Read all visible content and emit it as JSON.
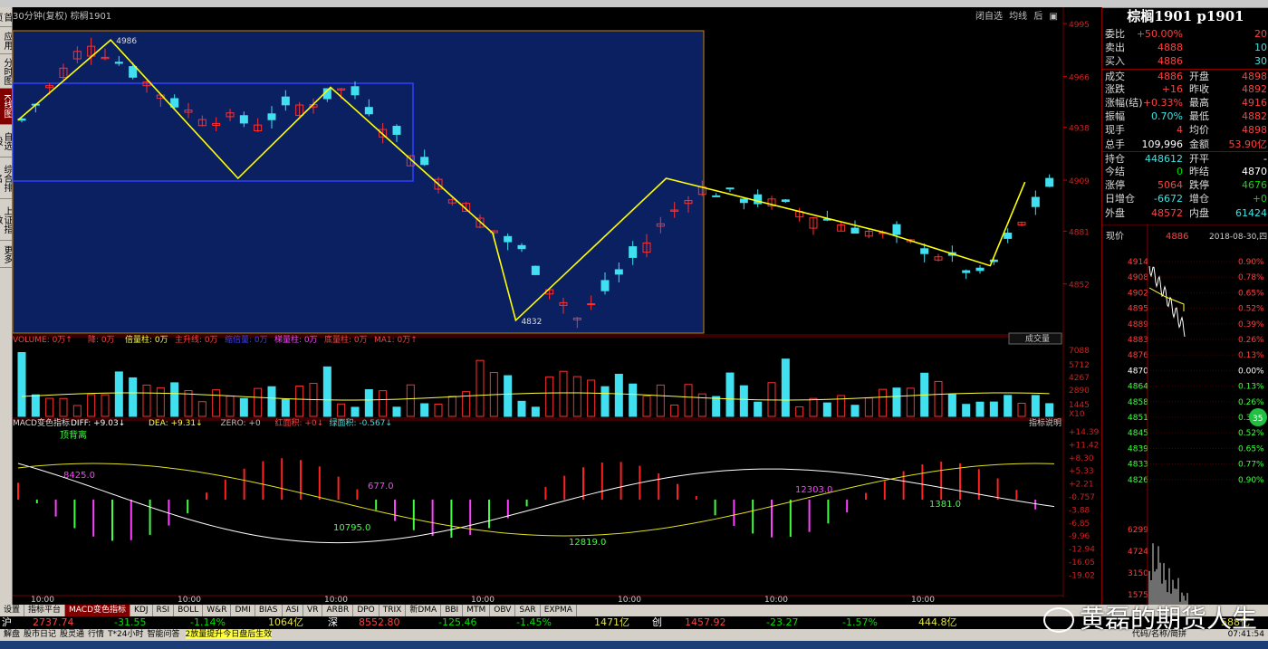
{
  "chart_header": {
    "period": "30分钟(复权)",
    "symbol": "棕榈1901"
  },
  "top_buttons": [
    "闭自选",
    "均线",
    "后"
  ],
  "left_tabs": [
    "首页",
    "应用",
    "分时图",
    "K线图",
    "自选股",
    "综合排名",
    "上证指数",
    "更多"
  ],
  "price_axis": [
    "4995",
    "4966",
    "4938",
    "4909",
    "4881",
    "4852"
  ],
  "price_annotations": {
    "high": "4986",
    "low": "4832"
  },
  "volume_header": {
    "items": [
      "VOLUME: 0万↑",
      "降: 0万",
      "倍量柱: 0万",
      "主升线: 0万",
      "缩倍量: 0万",
      "梯量柱: 0万",
      "底量柱: 0万",
      "MA1: 0万↑"
    ],
    "dropdown": "成交量"
  },
  "volume_axis": [
    "7088",
    "5712",
    "4267",
    "2890",
    "1445",
    "X10"
  ],
  "macd_header": {
    "name": "MACD变色指标",
    "items": [
      "DIFF: +9.03↓",
      "DEA: +9.31↓",
      "ZERO: +0",
      "红面积: +0↓",
      "绿面积: -0.567↓"
    ],
    "help": "指标说明"
  },
  "macd_axis": [
    "+14.39",
    "+11.42",
    "+8.30",
    "+5.33",
    "+2.21",
    "-0.757",
    "-3.88",
    "-6.85",
    "-9.96",
    "-12.94",
    "-16.05",
    "-19.02"
  ],
  "macd_labels": [
    "顶背离",
    "8425.0",
    "677.0",
    "10795.0",
    "12819.0",
    "12303.0",
    "1381.0"
  ],
  "time_axis": [
    "10:00",
    "10:00",
    "10:00",
    "10:00",
    "10:00",
    "10:00",
    "10:00"
  ],
  "quote": {
    "title": "棕榈1901 p1901",
    "rows": [
      {
        "l": "委比",
        "v1": "+50.00%",
        "l2": "",
        "v2": "20"
      },
      {
        "l": "卖出",
        "v1": "4888",
        "l2": "",
        "v2": "10"
      },
      {
        "l": "买入",
        "v1": "4886",
        "l2": "",
        "v2": "30"
      },
      {
        "l": "成交",
        "v1": "4886",
        "l2": "开盘",
        "v2": "4898"
      },
      {
        "l": "涨跌",
        "v1": "+16",
        "l2": "昨收",
        "v2": "4892"
      },
      {
        "l": "涨幅(结)",
        "v1": "+0.33%",
        "l2": "最高",
        "v2": "4916"
      },
      {
        "l": "振幅",
        "v1": "0.70%",
        "l2": "最低",
        "v2": "4882"
      },
      {
        "l": "现手",
        "v1": "4",
        "l2": "均价",
        "v2": "4898"
      },
      {
        "l": "总手",
        "v1": "109,996",
        "l2": "金额",
        "v2": "53.90亿"
      },
      {
        "l": "持仓",
        "v1": "448612",
        "l2": "开平",
        "v2": "-"
      },
      {
        "l": "今结",
        "v1": "0",
        "l2": "昨结",
        "v2": "4870"
      },
      {
        "l": "涨停",
        "v1": "5064",
        "l2": "跌停",
        "v2": "4676"
      },
      {
        "l": "日增仓",
        "v1": "-6672",
        "l2": "增仓",
        "v2": "+0"
      },
      {
        "l": "外盘",
        "v1": "48572",
        "l2": "内盘",
        "v2": "61424"
      }
    ],
    "mini_header": {
      "label": "现价",
      "value": "4886",
      "date": "2018-08-30,四"
    },
    "mini_price_axis": [
      "4914",
      "4908",
      "4902",
      "4895",
      "4889",
      "4883",
      "4876",
      "4870",
      "4864",
      "4858",
      "4851",
      "4845",
      "4839",
      "4833",
      "4826"
    ],
    "mini_pct_axis": [
      "0.90%",
      "0.78%",
      "0.65%",
      "0.52%",
      "0.39%",
      "0.26%",
      "0.13%",
      "0.00%",
      "0.13%",
      "0.26%",
      "0.39%",
      "0.52%",
      "0.65%",
      "0.77%",
      "0.90%"
    ],
    "mini_vol_axis": [
      "6299",
      "4724",
      "3150",
      "1575"
    ],
    "badge": "35"
  },
  "bottom_tabs": [
    "设置",
    "指标平台",
    "MACD变色指标",
    "KDJ",
    "RSI",
    "BOLL",
    "W&R",
    "DMI",
    "BIAS",
    "ASI",
    "VR",
    "ARBR",
    "DPO",
    "TRIX",
    "新DMA",
    "BBI",
    "MTM",
    "OBV",
    "SAR",
    "EXPMA"
  ],
  "index_bar": {
    "sh": {
      "name": "沪",
      "price": "2737.74",
      "chg": "-31.55",
      "pct": "-1.14%",
      "amt": "1064亿"
    },
    "sz": {
      "name": "深",
      "price": "8552.80",
      "chg": "-125.46",
      "pct": "-1.45%",
      "amt": "1471亿"
    },
    "cy": {
      "name": "创",
      "price": "1457.92",
      "chg": "-23.27",
      "pct": "-1.57%",
      "amt": "444.8亿"
    },
    "right": "588亿"
  },
  "status_bar": {
    "items": [
      "解盘",
      "股市日记",
      "股灵通",
      "行情",
      "T*24小时",
      "智能问答"
    ],
    "ticker": "2放量提升今日盘后生效",
    "right": [
      "代码/名称/简拼",
      "07:41:54"
    ]
  },
  "watermark": "黄磊的期货人生",
  "colors": {
    "up": "#ff3030",
    "down": "#40e0f0",
    "bg": "#000000",
    "highlight_box": "#0a2060",
    "zigzag": "#ffff00"
  }
}
